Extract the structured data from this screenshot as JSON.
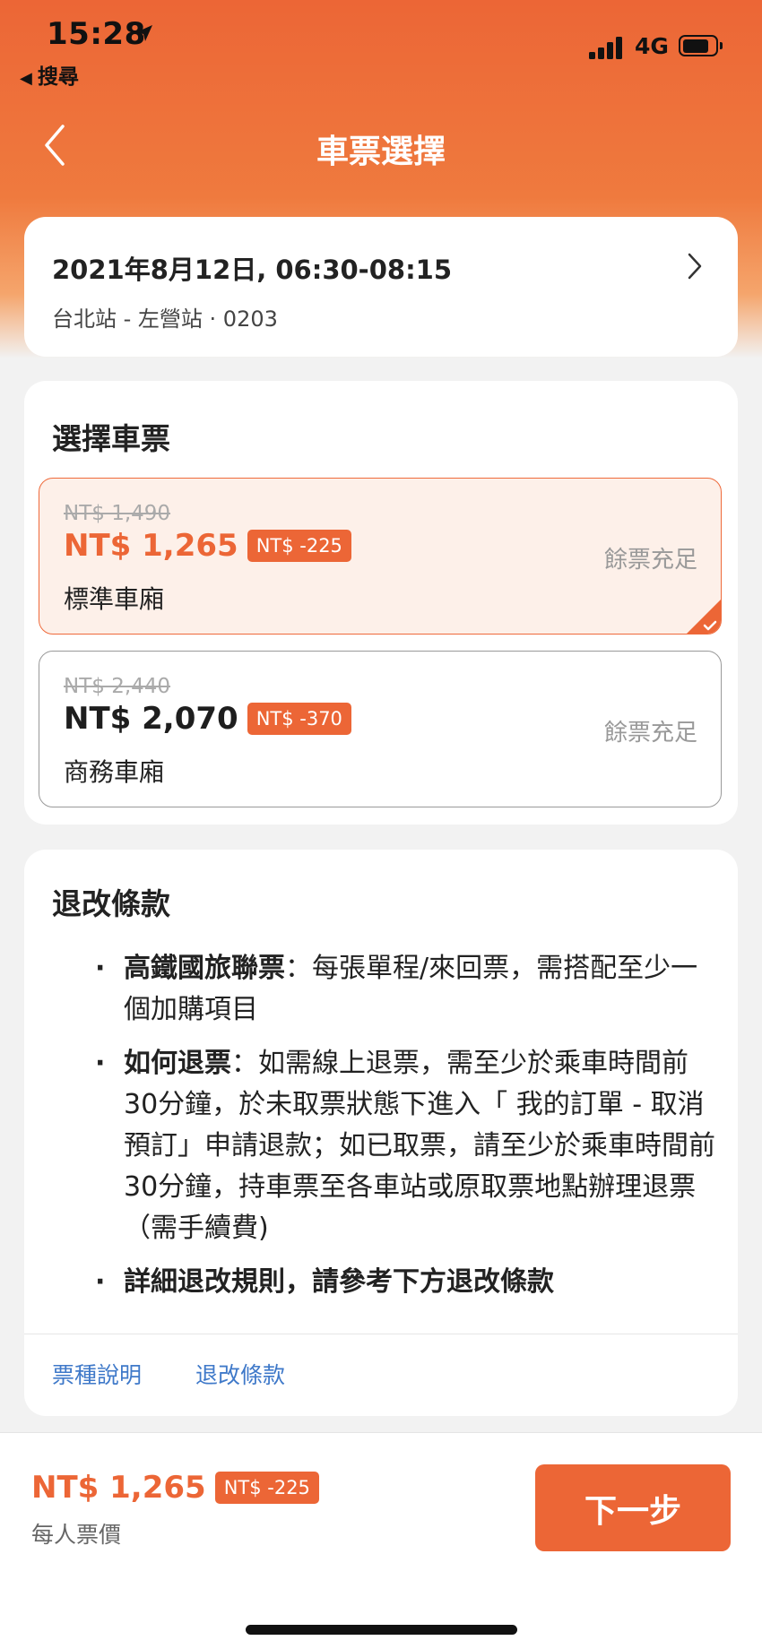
{
  "status_bar": {
    "time": "15:28",
    "back_app": "搜尋",
    "network": "4G"
  },
  "nav": {
    "title": "車票選擇"
  },
  "trip": {
    "datetime": "2021年8月12日, 06:30-08:15",
    "route": "台北站 - 左營站 · 0203"
  },
  "ticket_section": {
    "title": "選擇車票",
    "options": [
      {
        "original_price": "NT$ 1,490",
        "price": "NT$ 1,265",
        "discount": "NT$ -225",
        "name": "標準車廂",
        "stock": "餘票充足",
        "selected": true
      },
      {
        "original_price": "NT$ 2,440",
        "price": "NT$ 2,070",
        "discount": "NT$ -370",
        "name": "商務車廂",
        "stock": "餘票充足",
        "selected": false
      }
    ]
  },
  "refund_section": {
    "title": "退改條款",
    "rules": [
      {
        "bold": "高鐵國旅聯票",
        "text": "：每張單程/來回票，需搭配至少一個加購項目"
      },
      {
        "bold": "如何退票",
        "text": "：如需線上退票，需至少於乘車時間前30分鐘，於未取票狀態下進入「 我的訂單 - 取消預訂」申請退款；如已取票，請至少於乘車時間前30分鐘，持車票至各車站或原取票地點辦理退票（需手續費)"
      },
      {
        "bold": "詳細退改規則，請參考下方退改條款",
        "text": ""
      }
    ],
    "links": [
      "票種說明",
      "退改條款"
    ]
  },
  "bottom_bar": {
    "price": "NT$ 1,265",
    "discount": "NT$ -225",
    "note": "每人票價",
    "next_label": "下一步"
  },
  "colors": {
    "brand": "#ec6636",
    "link": "#3f79c9"
  }
}
